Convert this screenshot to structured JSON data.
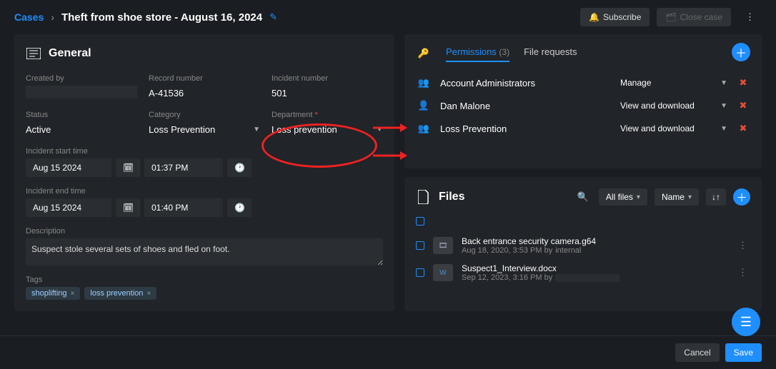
{
  "breadcrumb": {
    "root": "Cases",
    "title": "Theft from shoe store - August 16, 2024"
  },
  "header": {
    "subscribe": "Subscribe",
    "close_case": "Close case"
  },
  "general": {
    "title": "General",
    "created_by_label": "Created by",
    "record_number_label": "Record number",
    "record_number": "A-41536",
    "incident_number_label": "Incident number",
    "incident_number": "501",
    "status_label": "Status",
    "status": "Active",
    "category_label": "Category",
    "category": "Loss Prevention",
    "department_label": "Department",
    "department": "Loss prevention",
    "incident_start_label": "Incident start time",
    "incident_start_date": "Aug 15 2024",
    "incident_start_time": "01:37 PM",
    "incident_end_label": "Incident end time",
    "incident_end_date": "Aug 15 2024",
    "incident_end_time": "01:40 PM",
    "description_label": "Description",
    "description": "Suspect stole several sets of shoes and fled on foot.",
    "tags_label": "Tags",
    "tags": [
      "shoplifting",
      "loss prevention"
    ]
  },
  "permissions": {
    "tab_label": "Permissions",
    "tab_count": "(3)",
    "file_requests_label": "File requests",
    "rows": [
      {
        "name": "Account Administrators",
        "level": "Manage"
      },
      {
        "name": "Dan Malone",
        "level": "View and download"
      },
      {
        "name": "Loss Prevention",
        "level": "View and download"
      }
    ]
  },
  "files": {
    "title": "Files",
    "filter": "All files",
    "sort": "Name",
    "rows": [
      {
        "name": "Back entrance security camera.g64",
        "meta_prefix": "Aug 18, 2020, 3:53 PM by",
        "meta_suffix": "internal"
      },
      {
        "name": "Suspect1_Interview.docx",
        "meta_prefix": "Sep 12, 2023, 3:16 PM by",
        "meta_suffix": ""
      }
    ]
  },
  "footer": {
    "cancel": "Cancel",
    "save": "Save"
  }
}
